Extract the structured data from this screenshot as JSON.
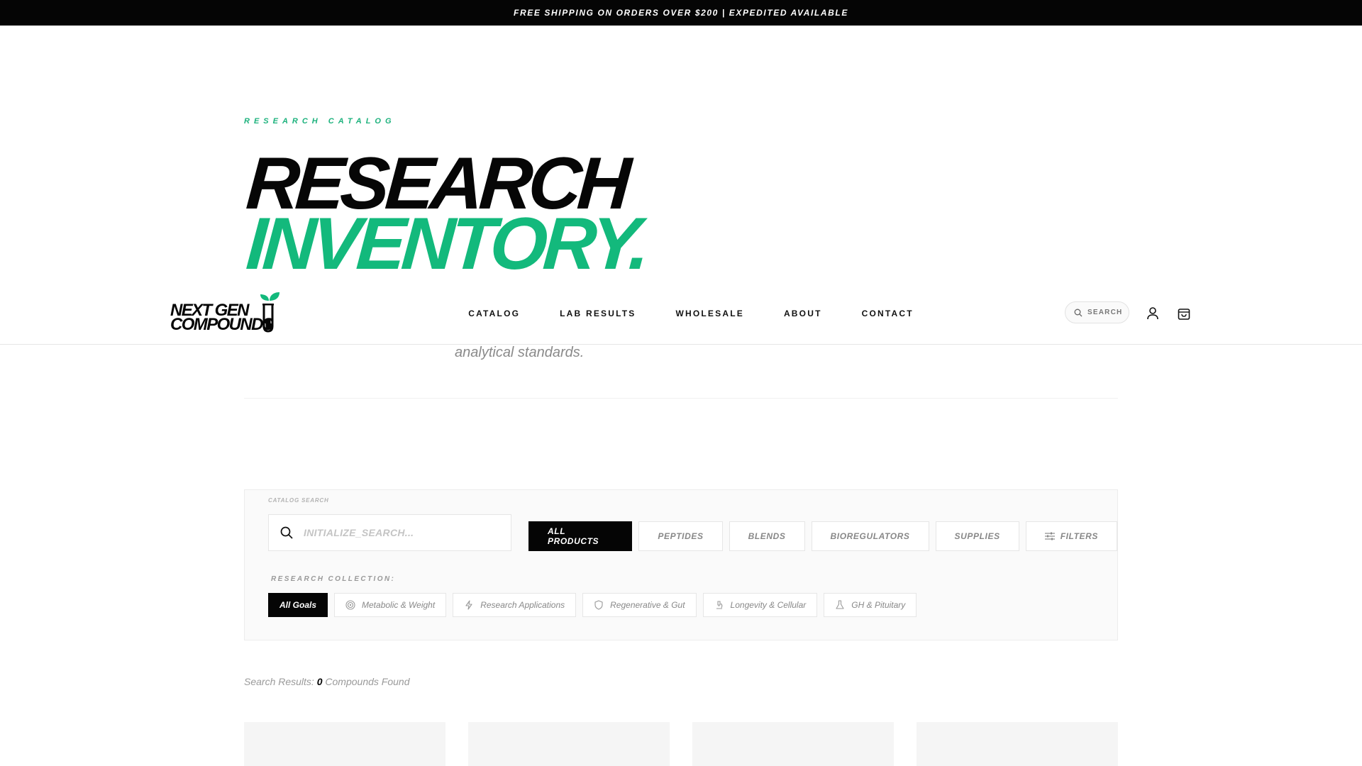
{
  "announcement": "FREE SHIPPING ON ORDERS OVER $200 | EXPEDITED AVAILABLE",
  "hero": {
    "eyebrow": "RESEARCH CATALOG",
    "line1": "RESEARCH",
    "line2": "INVENTORY.",
    "subtitle_fragment": "analytical standards."
  },
  "brand": {
    "line1": "NEXT GEN",
    "line2": "COMPOUNDS",
    "accent": "#13b97c"
  },
  "nav": {
    "items": [
      "CATALOG",
      "LAB RESULTS",
      "WHOLESALE",
      "ABOUT",
      "CONTACT"
    ],
    "search_label": "SEARCH"
  },
  "catalog": {
    "label": "CATALOG SEARCH",
    "search_placeholder": "INITIALIZE_SEARCH...",
    "tabs": [
      "ALL PRODUCTS",
      "PEPTIDES",
      "BLENDS",
      "BIOREGULATORS",
      "SUPPLIES",
      "FILTERS"
    ],
    "active_tab": "ALL PRODUCTS",
    "collection_label": "RESEARCH COLLECTION:",
    "goals": [
      {
        "label": "All Goals",
        "icon": ""
      },
      {
        "label": "Metabolic & Weight",
        "icon": "target-icon"
      },
      {
        "label": "Research Applications",
        "icon": "lightning-icon"
      },
      {
        "label": "Regenerative & Gut",
        "icon": "shield-icon"
      },
      {
        "label": "Longevity & Cellular",
        "icon": "microscope-icon"
      },
      {
        "label": "GH & Pituitary",
        "icon": "flask-icon"
      }
    ],
    "active_goal": "All Goals"
  },
  "results": {
    "prefix": "Search Results:",
    "count": "0",
    "suffix": "Compounds Found"
  }
}
